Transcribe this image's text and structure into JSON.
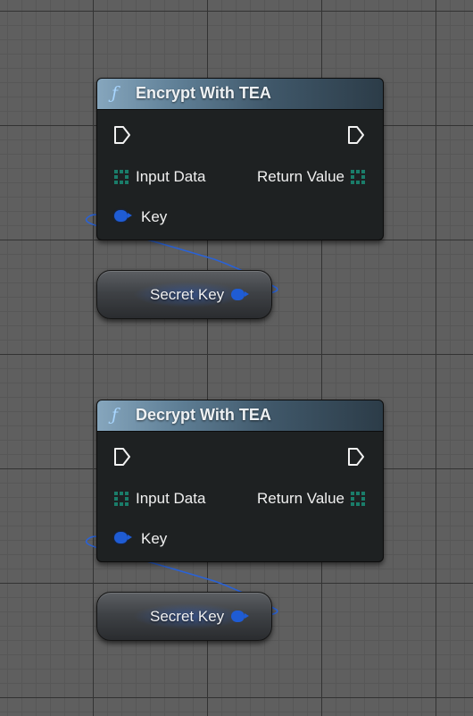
{
  "nodes": [
    {
      "title": "Encrypt With TEA",
      "function_icon": "function-icon",
      "input_label": "Input Data",
      "return_label": "Return Value",
      "key_label": "Key"
    },
    {
      "title": "Decrypt With TEA",
      "function_icon": "function-icon",
      "input_label": "Input Data",
      "return_label": "Return Value",
      "key_label": "Key"
    }
  ],
  "variables": [
    {
      "label": "Secret Key"
    },
    {
      "label": "Secret Key"
    }
  ],
  "colors": {
    "header_accent": "#86a6bd",
    "key_pin": "#1f5cd4",
    "wire": "#2a62d6",
    "byte_array_pin": "#1a7d6a",
    "node_body": "#1e2122"
  }
}
